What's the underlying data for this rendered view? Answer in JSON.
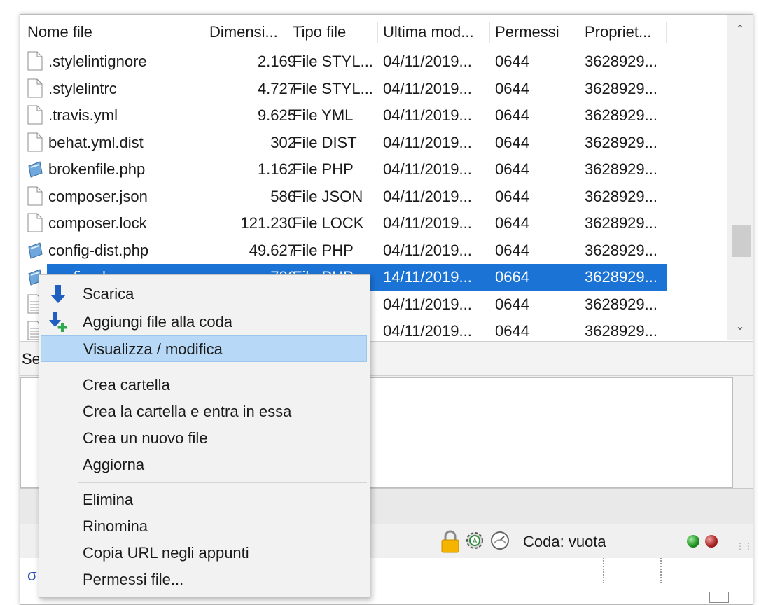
{
  "columns": {
    "name": "Nome file",
    "size": "Dimensi...",
    "type": "Tipo file",
    "modified": "Ultima mod...",
    "perms": "Permessi",
    "owner": "Propriet..."
  },
  "files": [
    {
      "name": ".stylelintignore",
      "size": "2.169",
      "type": "File STYL...",
      "date": "04/11/2019...",
      "perm": "0644",
      "owner": "3628929...",
      "icon": "blank-file-icon"
    },
    {
      "name": ".stylelintrc",
      "size": "4.727",
      "type": "File STYL...",
      "date": "04/11/2019...",
      "perm": "0644",
      "owner": "3628929...",
      "icon": "blank-file-icon"
    },
    {
      "name": ".travis.yml",
      "size": "9.625",
      "type": "File YML",
      "date": "04/11/2019...",
      "perm": "0644",
      "owner": "3628929...",
      "icon": "blank-file-icon"
    },
    {
      "name": "behat.yml.dist",
      "size": "302",
      "type": "File DIST",
      "date": "04/11/2019...",
      "perm": "0644",
      "owner": "3628929...",
      "icon": "blank-file-icon"
    },
    {
      "name": "brokenfile.php",
      "size": "1.162",
      "type": "File PHP",
      "date": "04/11/2019...",
      "perm": "0644",
      "owner": "3628929...",
      "icon": "php-file-icon"
    },
    {
      "name": "composer.json",
      "size": "586",
      "type": "File JSON",
      "date": "04/11/2019...",
      "perm": "0644",
      "owner": "3628929...",
      "icon": "blank-file-icon"
    },
    {
      "name": "composer.lock",
      "size": "121.230",
      "type": "File LOCK",
      "date": "04/11/2019...",
      "perm": "0644",
      "owner": "3628929...",
      "icon": "blank-file-icon"
    },
    {
      "name": "config-dist.php",
      "size": "49.627",
      "type": "File PHP",
      "date": "04/11/2019...",
      "perm": "0644",
      "owner": "3628929...",
      "icon": "php-file-icon"
    },
    {
      "name": "config.php",
      "size": "786",
      "type": "File PHP",
      "date": "14/11/2019...",
      "perm": "0664",
      "owner": "3628929...",
      "icon": "php-file-icon",
      "selected": true
    },
    {
      "name": "",
      "size": "",
      "type": "",
      "date": "04/11/2019...",
      "perm": "0644",
      "owner": "3628929...",
      "icon": "text-file-icon"
    },
    {
      "name": "",
      "size": "",
      "type": "",
      "date": "04/11/2019...",
      "perm": "0644",
      "owner": "3628929...",
      "icon": "text-file-icon"
    }
  ],
  "status_line": "Se",
  "bottom_bar": {
    "queue": "Coda: vuota"
  },
  "context_menu": {
    "download": "Scarica",
    "add_queue": "Aggiungi file alla coda",
    "view_edit": "Visualizza / modifica",
    "create_folder": "Crea cartella",
    "create_enter_folder": "Crea la cartella e entra in essa",
    "new_file": "Crea un nuovo file",
    "refresh": "Aggiorna",
    "delete": "Elimina",
    "rename": "Rinomina",
    "copy_url": "Copia URL negli appunti",
    "permissions": "Permessi file..."
  },
  "colors": {
    "selection": "#1c73d6",
    "menu_highlight": "#b7d8f6"
  }
}
